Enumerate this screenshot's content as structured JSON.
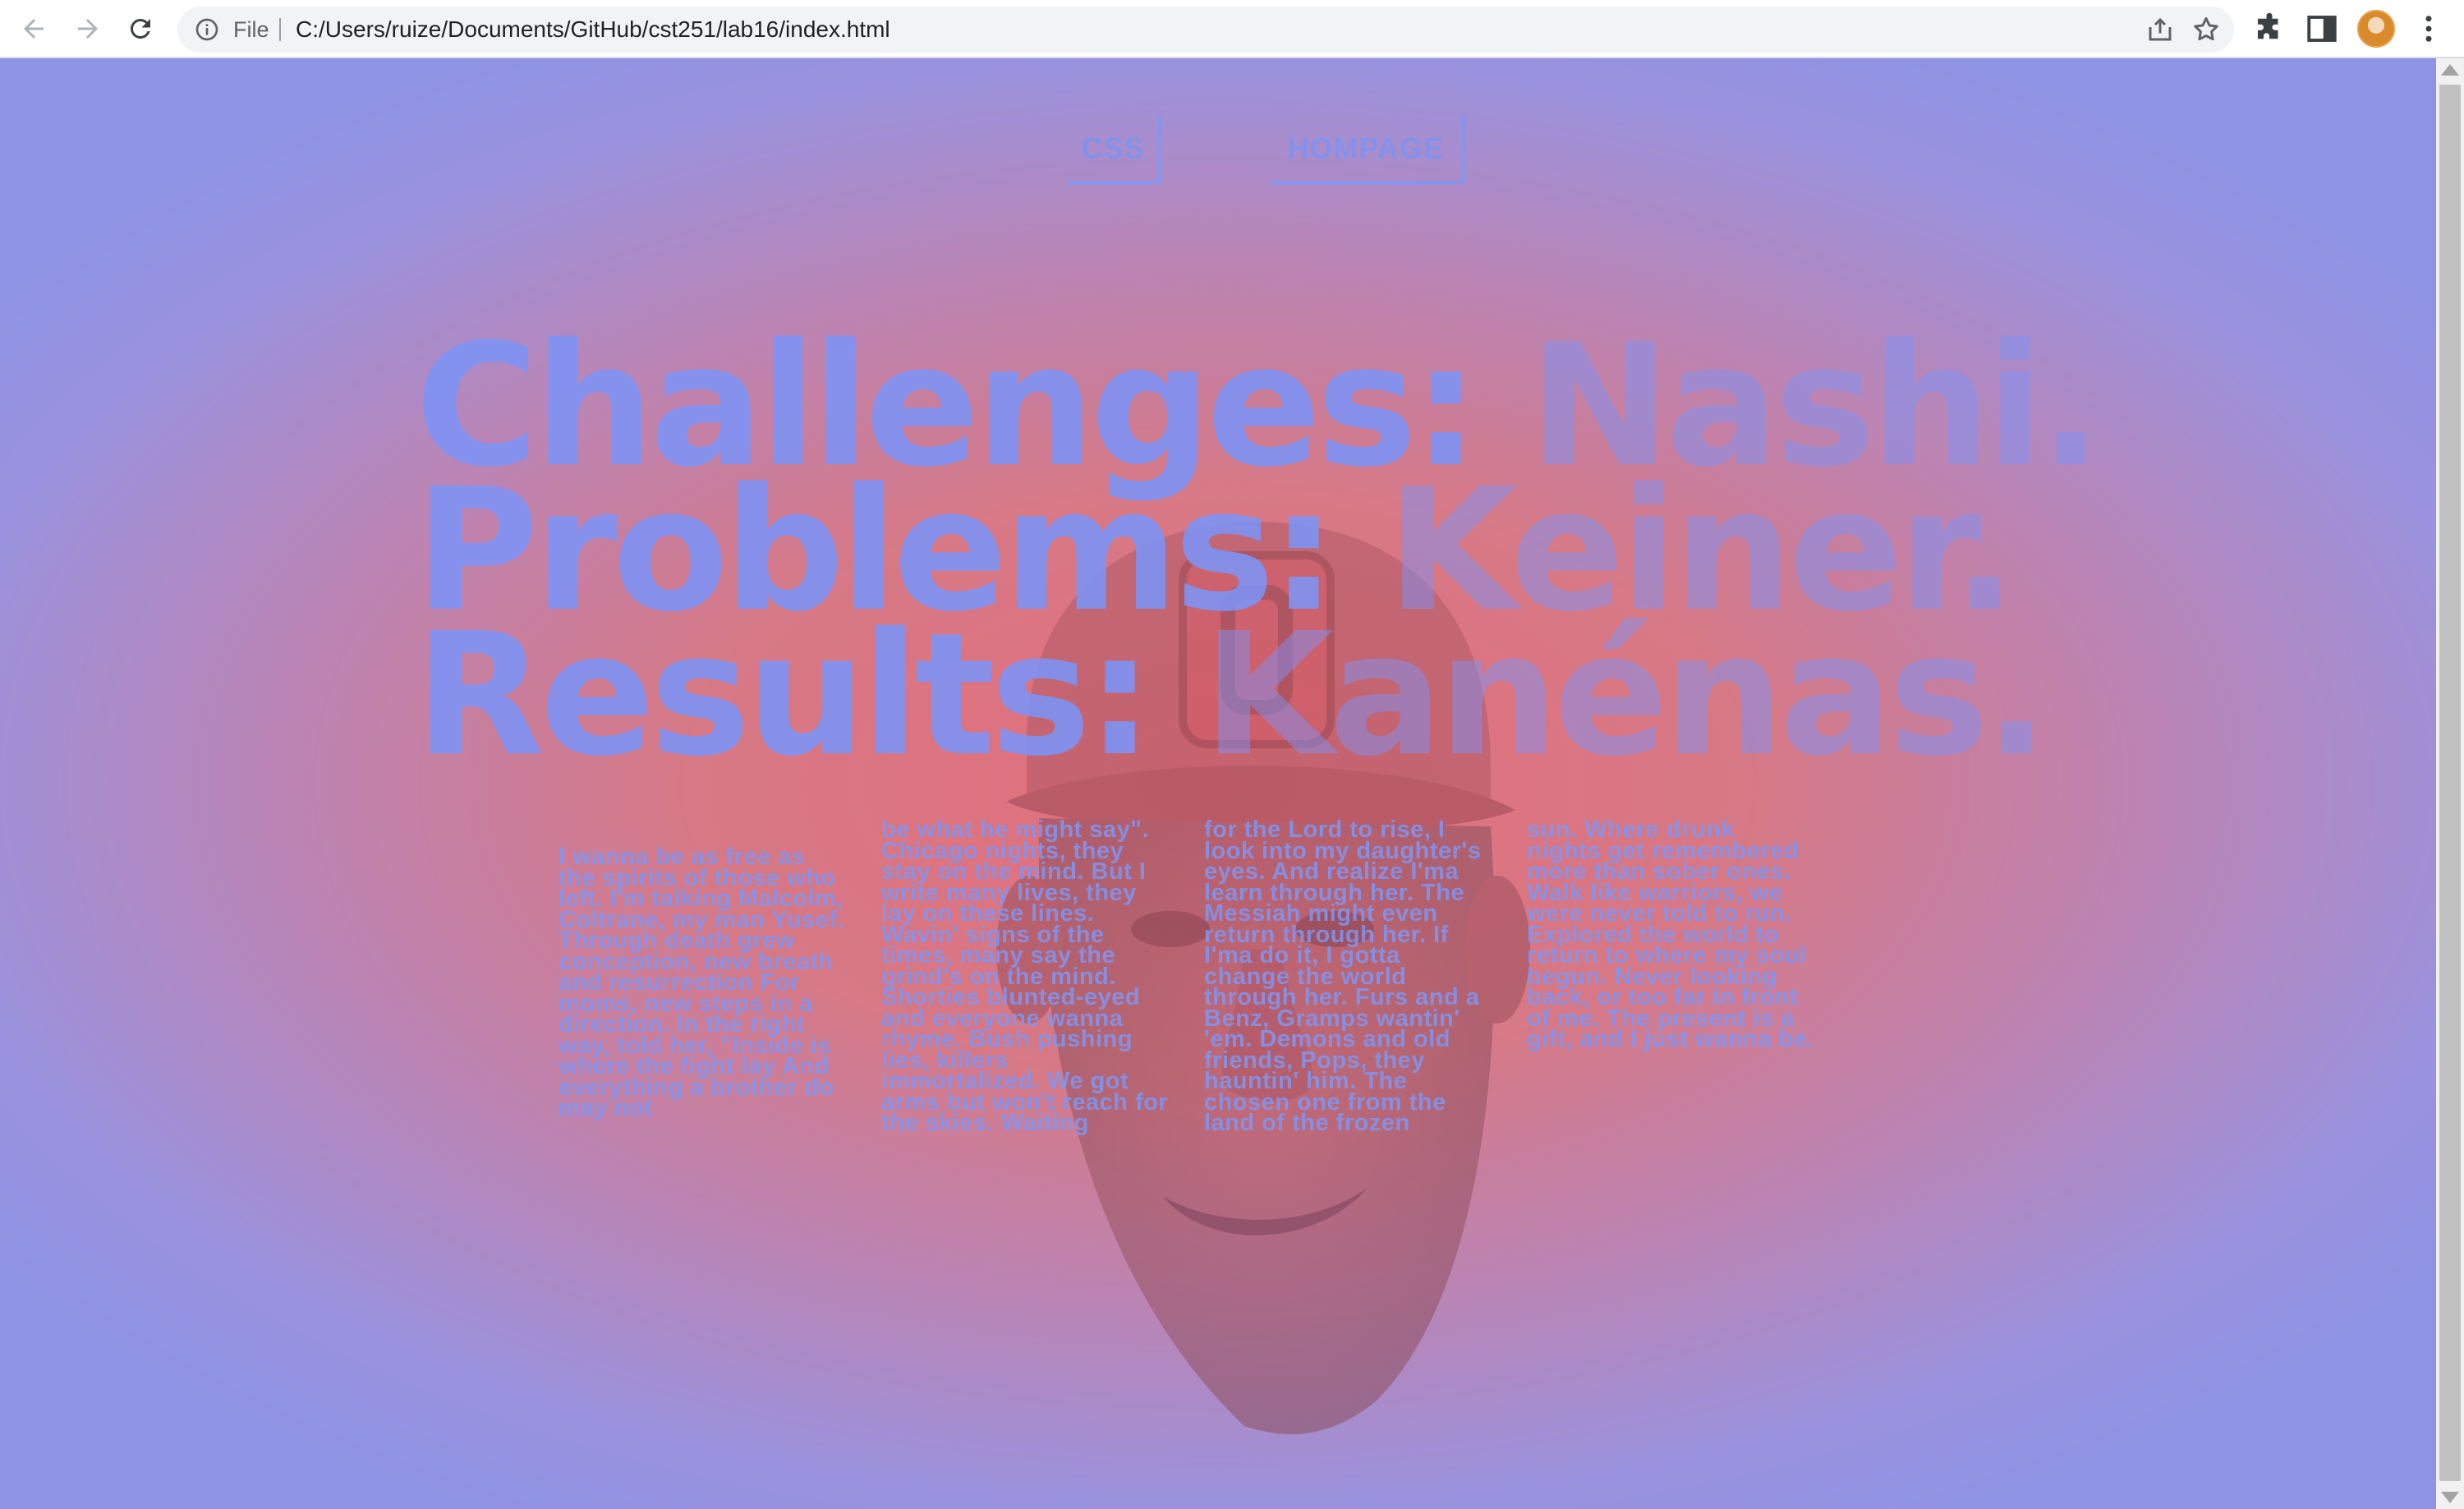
{
  "browser": {
    "address_scheme": "File",
    "address_url": "C:/Users/ruize/Documents/GitHub/cst251/lab16/index.html"
  },
  "page": {
    "nav": {
      "css_label": "CSS",
      "home_label": "HOMPAGE"
    },
    "headline": {
      "line1_a": "Challenges: ",
      "line1_b": "Nashi.",
      "line2_a": "Problems: ",
      "line2_b": "Keiner.",
      "line3_a": "Results: ",
      "line3_b": "Kanénas."
    },
    "lyrics": [
      "I wanna be as free as the spirits of those who left. I'm talking Malcolm, Coltrane, my man Yusef. Through death grew conception, new breath and resurrection For moms, new steps in a direction. In the right way, told her, \"Inside is where the fight lay And everything a brother do may not",
      "be what he might say\". Chicago nights, they stay on the mind. But I write many lives, they lay on these lines. Wavin' signs of the times, many say the grind's on the mind. Shorties blunted-eyed and everyone wanna rhyme. Bush pushing lies, killers immortalized. We got arms but won't reach for the skies. Waiting",
      "for the Lord to rise, I look into my daughter's eyes. And realize I'ma learn through her. The Messiah might even return through her. If I'ma do it, I gotta change the world through her. Furs and a Benz, Gramps wantin' 'em. Demons and old friends, Pops, they hauntin' him. The chosen one from the land of the frozen",
      "sun. Where drunk nights get remembered more than sober ones. Walk like warriors, we were never told to run. Explored the world to return to where my soul begun. Never looking back, or too far in front of me. The present is a gift, and I just wanna be."
    ]
  },
  "colors": {
    "accent_blue": "#7f93f4",
    "center_red": "#e36e7b",
    "edge_lavender": "#8e93e5"
  },
  "icons": {
    "back": "arrow-left",
    "forward": "arrow-right",
    "reload": "circular-arrow",
    "info": "info-circle",
    "share": "share-box",
    "bookmark": "star",
    "extensions": "puzzle-piece",
    "side_panel": "split-rectangle",
    "profile": "avatar",
    "menu": "three-dots-vertical"
  }
}
